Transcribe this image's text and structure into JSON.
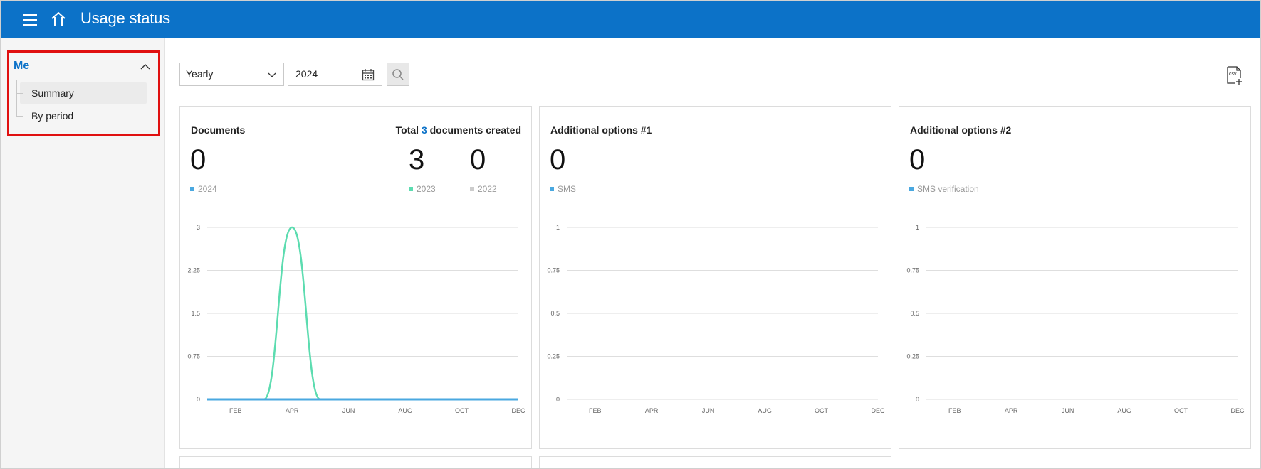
{
  "header": {
    "title": "Usage status"
  },
  "sidebar": {
    "group_title": "Me",
    "items": [
      {
        "label": "Summary",
        "active": true
      },
      {
        "label": "By period",
        "active": false
      }
    ]
  },
  "toolbar": {
    "period_select": "Yearly",
    "date_value": "2024"
  },
  "colors": {
    "accent": "#0c72c8",
    "series_2024": "#4aa8e0",
    "series_2023": "#5cdcb0",
    "series_2022": "#cccccc"
  },
  "cards": [
    {
      "title": "Documents",
      "note_prefix": "Total ",
      "note_count": "3",
      "note_suffix": " documents created",
      "stats": [
        {
          "value": "0",
          "label": "2024"
        },
        {
          "value": "3",
          "label": "2023"
        },
        {
          "value": "0",
          "label": "2022"
        }
      ]
    },
    {
      "title": "Additional options #1",
      "stats": [
        {
          "value": "0",
          "label": "SMS"
        }
      ]
    },
    {
      "title": "Additional options #2",
      "stats": [
        {
          "value": "0",
          "label": "SMS verification"
        }
      ]
    }
  ],
  "chart_data": [
    {
      "type": "line",
      "x_ticks": [
        "FEB",
        "APR",
        "JUN",
        "AUG",
        "OCT",
        "DEC"
      ],
      "y_ticks": [
        "0",
        "0.75",
        "1.5",
        "2.25",
        "3"
      ],
      "ylim": [
        0,
        3
      ],
      "series": [
        {
          "name": "2024",
          "color": "#4aa8e0",
          "values": [
            0,
            0,
            0,
            0,
            0,
            0,
            0,
            0,
            0,
            0,
            0,
            0
          ]
        },
        {
          "name": "2023",
          "color": "#5cdcb0",
          "values": [
            0,
            0,
            0,
            3,
            0,
            0,
            0,
            0,
            0,
            0,
            0,
            0
          ]
        }
      ]
    },
    {
      "type": "line",
      "x_ticks": [
        "FEB",
        "APR",
        "JUN",
        "AUG",
        "OCT",
        "DEC"
      ],
      "y_ticks": [
        "0",
        "0.25",
        "0.5",
        "0.75",
        "1"
      ],
      "ylim": [
        0,
        1
      ],
      "series": []
    },
    {
      "type": "line",
      "x_ticks": [
        "FEB",
        "APR",
        "JUN",
        "AUG",
        "OCT",
        "DEC"
      ],
      "y_ticks": [
        "0",
        "0.25",
        "0.5",
        "0.75",
        "1"
      ],
      "ylim": [
        0,
        1
      ],
      "series": []
    }
  ]
}
